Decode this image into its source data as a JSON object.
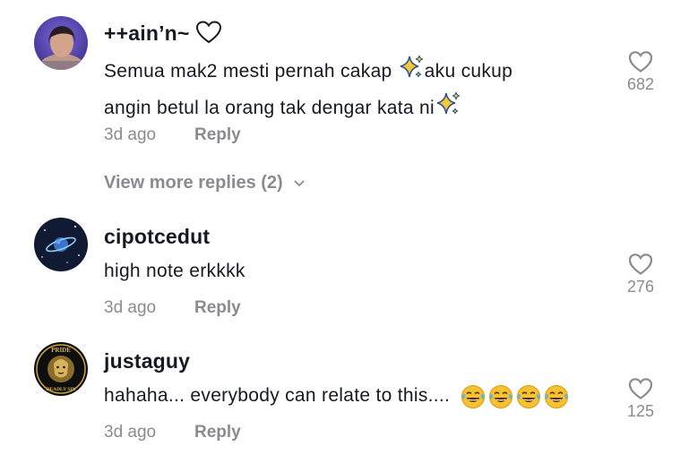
{
  "comments": [
    {
      "username": "++ain’n~",
      "username_icon": "heart-outline-icon",
      "text_line1_a": "Semua mak2 mesti pernah cakap ",
      "text_line1_b": "aku cukup",
      "text_line2": "angin betul la orang tak dengar kata ni",
      "time": "3d ago",
      "reply_label": "Reply",
      "likes": "682"
    },
    {
      "username": "cipotcedut",
      "text": "high note erkkkk",
      "time": "3d ago",
      "reply_label": "Reply",
      "likes": "276"
    },
    {
      "username": "justaguy",
      "text": "hahaha... everybody can relate to this.... ",
      "emoji": "tears-of-joy-icon",
      "emoji_count": 4,
      "time": "3d ago",
      "reply_label": "Reply",
      "likes": "125"
    }
  ],
  "view_more": {
    "label": "View more replies (2)"
  },
  "avatar_badge": {
    "top": "PRIDE",
    "bottom": "DEADLY SIN"
  },
  "colors": {
    "muted": "#8a8b91",
    "text": "#161823",
    "sparkle": "#f6c836"
  }
}
